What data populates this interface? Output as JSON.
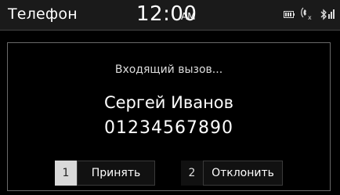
{
  "status_bar": {
    "app_title": "Телефон",
    "time": "12:00",
    "ampm": "AM",
    "icons": [
      "battery-icon",
      "signal-icon",
      "bluetooth-icon"
    ]
  },
  "call": {
    "status": "Входящий вызов...",
    "caller_name": "Сергей Иванов",
    "caller_number": "01234567890",
    "buttons": [
      {
        "num": "1",
        "label": "Принять"
      },
      {
        "num": "2",
        "label": "Отклонить"
      }
    ]
  },
  "colors": {
    "background": "#000000",
    "text": "#ffffff",
    "accept_number_bg": "#d9d9d9"
  }
}
